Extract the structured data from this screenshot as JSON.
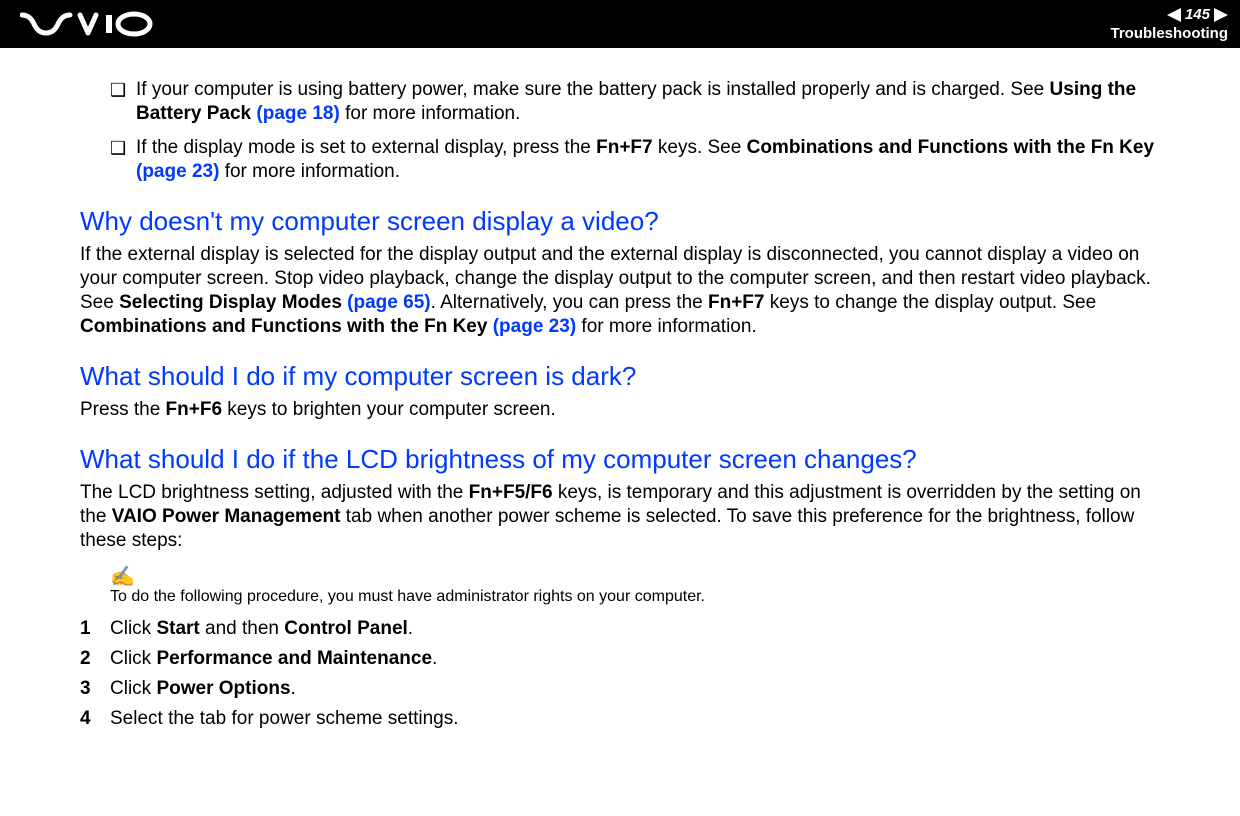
{
  "header": {
    "page_number": "145",
    "section": "Troubleshooting"
  },
  "bullets": {
    "b1_pre": "If your computer is using battery power, make sure the battery pack is installed properly and is charged. See ",
    "b1_bold1": "Using the Battery Pack ",
    "b1_link": "(page 18)",
    "b1_post": " for more information.",
    "b2_pre": "If the display mode is set to external display, press the ",
    "b2_bold1": "Fn+F7",
    "b2_mid": " keys. See ",
    "b2_bold2": "Combinations and Functions with the Fn Key ",
    "b2_link": "(page 23)",
    "b2_post": " for more information."
  },
  "section1": {
    "heading": "Why doesn't my computer screen display a video?",
    "p_pre": "If the external display is selected for the display output and the external display is disconnected, you cannot display a video on your computer screen. Stop video playback, change the display output to the computer screen, and then restart video playback. See ",
    "p_bold1": "Selecting Display Modes ",
    "p_link1": "(page 65)",
    "p_mid": ". Alternatively, you can press the ",
    "p_bold2": "Fn+F7",
    "p_mid2": " keys to change the display output. See ",
    "p_bold3": "Combinations and Functions with the Fn Key ",
    "p_link2": "(page 23)",
    "p_post": " for more information."
  },
  "section2": {
    "heading": "What should I do if my computer screen is dark?",
    "p_pre": "Press the ",
    "p_bold": "Fn+F6",
    "p_post": " keys to brighten your computer screen."
  },
  "section3": {
    "heading": "What should I do if the LCD brightness of my computer screen changes?",
    "p_pre": "The LCD brightness setting, adjusted with the ",
    "p_bold1": "Fn+F5/F6",
    "p_mid": " keys, is temporary and this adjustment is overridden by the setting on the ",
    "p_bold2": "VAIO Power Management",
    "p_post": " tab when another power scheme is selected. To save this preference for the brightness, follow these steps:",
    "note_icon": "✍",
    "note": "To do the following procedure, you must have administrator rights on your computer.",
    "steps": {
      "s1_num": "1",
      "s1_pre": "Click ",
      "s1_bold1": "Start",
      "s1_mid": " and then ",
      "s1_bold2": "Control Panel",
      "s1_post": ".",
      "s2_num": "2",
      "s2_pre": "Click ",
      "s2_bold": "Performance and Maintenance",
      "s2_post": ".",
      "s3_num": "3",
      "s3_pre": "Click ",
      "s3_bold": "Power Options",
      "s3_post": ".",
      "s4_num": "4",
      "s4_text": "Select the tab for power scheme settings."
    }
  }
}
